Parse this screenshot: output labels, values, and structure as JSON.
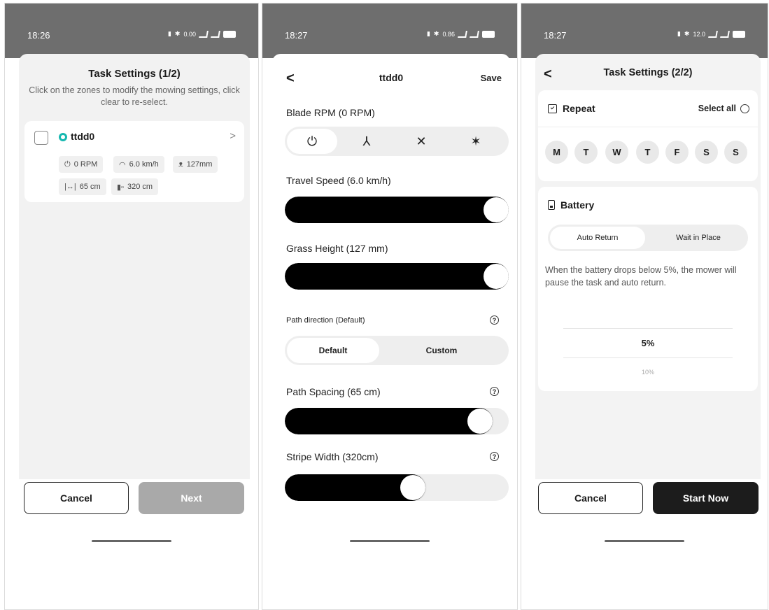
{
  "screen1": {
    "status": {
      "time": "18:26",
      "net_speed": "0.00"
    },
    "title": "Task Settings (1/2)",
    "subtitle": "Click on the zones to modify the mowing settings, click clear to re-select.",
    "zone": {
      "name": "ttdd0",
      "chips": {
        "rpm": "0 RPM",
        "speed": "6.0 km/h",
        "height": "127mm",
        "spacing": "65 cm",
        "stripe": "320 cm"
      }
    },
    "cancel_label": "Cancel",
    "next_label": "Next"
  },
  "screen2": {
    "status": {
      "time": "18:27",
      "net_speed": "0.86"
    },
    "back_label": "<",
    "title": "ttdd0",
    "save_label": "Save",
    "blade_rpm_label": "Blade RPM (0 RPM)",
    "blade_rpm_selected": 0,
    "travel_speed_label": "Travel Speed (6.0 km/h)",
    "travel_speed_level": 1.0,
    "grass_height_label": "Grass Height (127 mm)",
    "grass_height_level": 1.0,
    "path_direction_label": "Path direction (Default)",
    "path_direction_options": [
      "Default",
      "Custom"
    ],
    "path_direction_selected": "Default",
    "path_spacing_label": "Path Spacing (65 cm)",
    "path_spacing_level": 0.92,
    "stripe_width_label": "Stripe Width (320cm)",
    "stripe_width_level": 0.58
  },
  "screen3": {
    "status": {
      "time": "18:27",
      "net_speed": "12.0"
    },
    "back_label": "<",
    "title": "Task Settings (2/2)",
    "repeat_label": "Repeat",
    "select_all_label": "Select all",
    "days": [
      "M",
      "T",
      "W",
      "T",
      "F",
      "S",
      "S"
    ],
    "battery_label": "Battery",
    "battery_options": [
      "Auto Return",
      "Wait in Place"
    ],
    "battery_selected": "Auto Return",
    "battery_description": "When the battery drops below 5%, the mower will pause the task and auto return.",
    "picker_selected": "5%",
    "picker_next": "10%",
    "cancel_label": "Cancel",
    "start_label": "Start Now"
  }
}
